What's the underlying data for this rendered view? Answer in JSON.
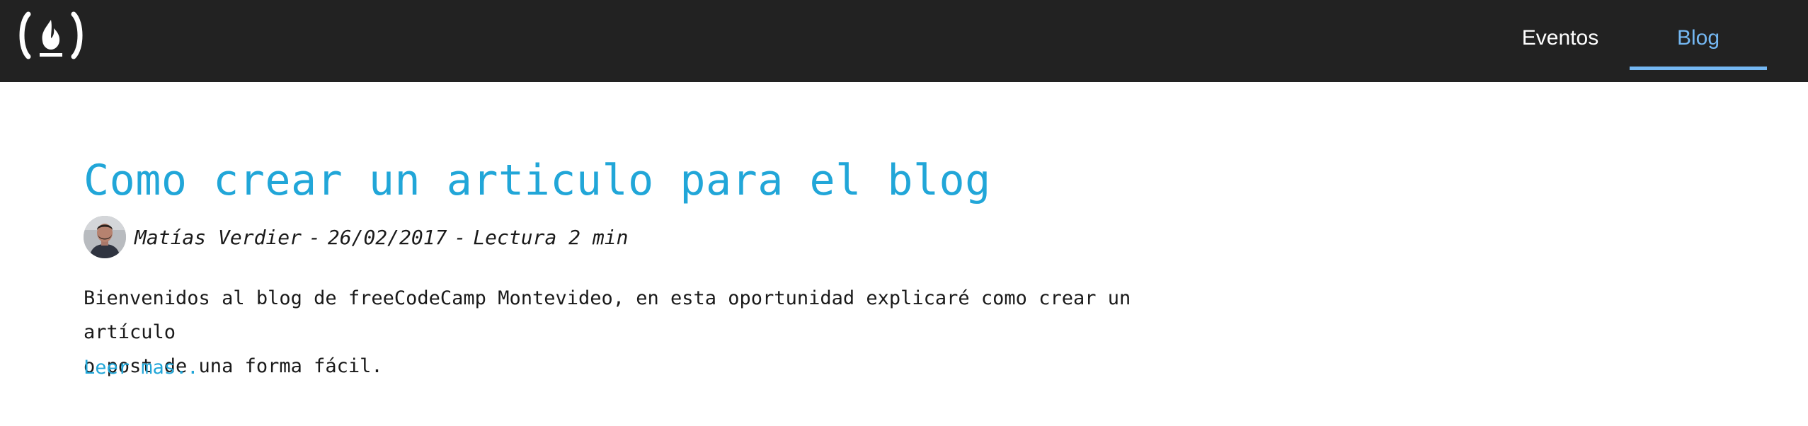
{
  "header": {
    "logo_icon": "freecodecamp-flame-logo-icon",
    "nav": {
      "items": [
        {
          "label": "Eventos",
          "active": false
        },
        {
          "label": "Blog",
          "active": true
        }
      ]
    }
  },
  "post": {
    "title": "Como crear un articulo para el blog",
    "meta": {
      "author": "Matías Verdier",
      "separator": "-",
      "date": "26/02/2017",
      "reading_time": "Lectura 2 min"
    },
    "excerpt_line1": "Bienvenidos al blog de freeCodeCamp Montevideo, en esta oportunidad explicaré como crear un artículo",
    "excerpt_line2": "o post de una forma fácil.",
    "read_more": "Leer mas.."
  },
  "colors": {
    "header_bg": "#222222",
    "nav_accent": "#74b7f2",
    "title_accent": "#21a6d8",
    "text": "#1a1a1a"
  }
}
